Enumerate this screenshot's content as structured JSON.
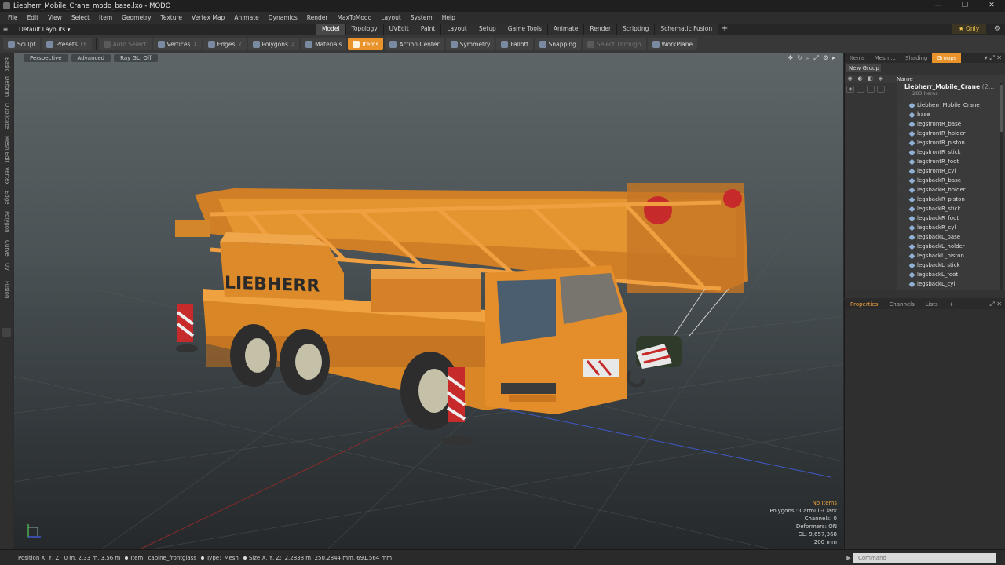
{
  "window": {
    "title": "Liebherr_Mobile_Crane_modo_base.lxo - MODO",
    "minimize_label": "—",
    "maximize_label": "❐",
    "close_label": "✕"
  },
  "menu": [
    "File",
    "Edit",
    "View",
    "Select",
    "Item",
    "Geometry",
    "Texture",
    "Vertex Map",
    "Animate",
    "Dynamics",
    "Render",
    "MaxToModo",
    "Layout",
    "System",
    "Help"
  ],
  "layout_row": {
    "layout_select": "Default Layouts ▾",
    "tabs": [
      "Model",
      "Topology",
      "UVEdit",
      "Paint",
      "Layout",
      "Setup",
      "Game Tools",
      "Animate",
      "Render",
      "Scripting",
      "Schematic Fusion"
    ],
    "active_tab": "Model",
    "add_tab": "+",
    "only_label": "Only",
    "only_icon": "★",
    "gear_icon": "⚙"
  },
  "toolbar": {
    "sculpt": "Sculpt",
    "presets": "Presets",
    "presets_shortcut": "F6",
    "auto_select": "Auto Select",
    "vertices": "Vertices",
    "vertices_shortcut": "1",
    "edges": "Edges",
    "edges_shortcut": "2",
    "polygons": "Polygons",
    "polygons_shortcut": "3",
    "materials": "Materials",
    "items": "Items",
    "action_center": "Action Center",
    "symmetry": "Symmetry",
    "falloff": "Falloff",
    "snapping": "Snapping",
    "select_through": "Select Through",
    "workplane": "WorkPlane"
  },
  "left_tabs": [
    "Basic",
    "Deform",
    "Duplicate",
    "Mesh Edit",
    "Vertex",
    "Edge",
    "Polygon",
    "Curve",
    "UV",
    "Fusion"
  ],
  "viewport": {
    "perspective": "Perspective",
    "advanced": "Advanced",
    "ray_gl": "Ray GL: Off",
    "brand_text": "LIEBHERR",
    "stats": {
      "no_items": "No Items",
      "polygons": "Polygons : Catmull-Clark",
      "channels": "Channels: 0",
      "deformers": "Deformers: ON",
      "gl": "GL: 9,657,368",
      "scale": "200 mm"
    }
  },
  "items_panel": {
    "tabs": [
      "Items",
      "Mesh ...",
      "Shading",
      "Groups"
    ],
    "active_tab": "Groups",
    "new_group": "New Group",
    "name_header": "Name",
    "root_name": "Liebherr_Mobile_Crane",
    "root_suffix": "(2...",
    "root_count": "283 Items",
    "items": [
      "Liebherr_Mobile_Crane",
      "base",
      "legsfrontR_base",
      "legsfrontR_holder",
      "legsfrontR_piston",
      "legsfrontR_stick",
      "legsfrontR_foot",
      "legsfrontR_cyl",
      "legsbackR_base",
      "legsbackR_holder",
      "legsbackR_piston",
      "legsbackR_stick",
      "legsbackR_foot",
      "legsbackR_cyl",
      "legsbackL_base",
      "legsbackL_holder",
      "legsbackL_piston",
      "legsbackL_stick",
      "legsbackL_foot",
      "legsbackL_cyl"
    ]
  },
  "properties_panel": {
    "tabs": [
      "Properties",
      "Channels",
      "Lists"
    ],
    "active_tab": "Properties",
    "add_tab": "+"
  },
  "statusbar": {
    "position_label": "Position X, Y, Z:",
    "position_value": "0 m, 2.33 m, 3.56 m",
    "item_label": "Item:",
    "item_value": "cabine_frontglass",
    "type_label": "Type:",
    "type_value": "Mesh",
    "size_label": "Size X, Y, Z:",
    "size_value": "2.2838 m, 250.2844 mm, 691.564 mm"
  },
  "command": {
    "placeholder": "Command",
    "arrow": "▶"
  },
  "colors": {
    "accent": "#e9932a",
    "crane_orange": "#e58a2a",
    "crane_dark": "#b8661c"
  }
}
